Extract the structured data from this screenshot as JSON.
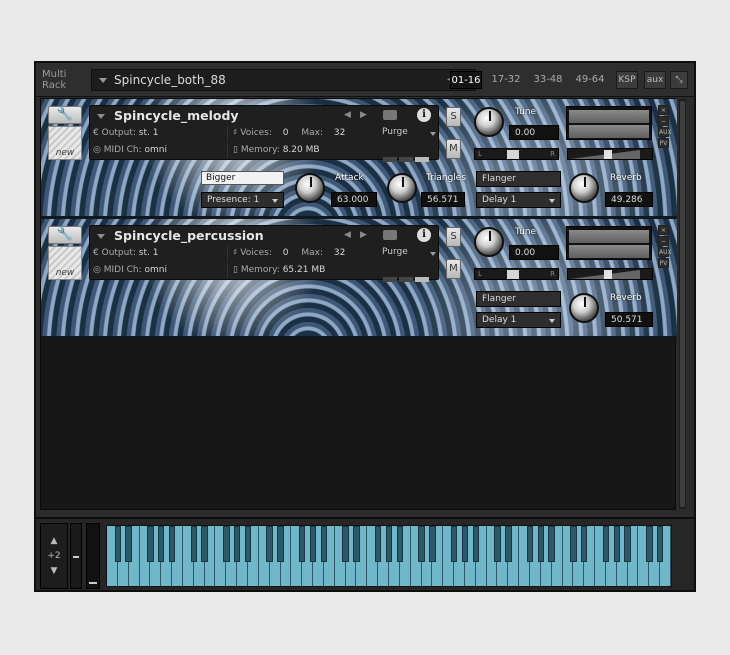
{
  "topbar": {
    "multi_rack_label": "Multi\nRack",
    "rack_name": "Spincycle_both_88",
    "pages": [
      "01-16",
      "17-32",
      "33-48",
      "49-64"
    ],
    "active_page": "01-16",
    "ksp_label": "KSP",
    "aux_label": "aux",
    "collapse_icon": "collapse-arrows-icon"
  },
  "instruments": [
    {
      "name": "Spincycle_melody",
      "output_label": "Output:",
      "output_value": "st. 1",
      "voices_label": "Voices:",
      "voices_value": "0",
      "max_label": "Max:",
      "max_value": "32",
      "midi_label": "MIDI Ch:",
      "midi_value": "omni",
      "memory_label": "Memory:",
      "memory_value": "8.20 MB",
      "purge_label": "Purge",
      "s_label": "S",
      "m_label": "M",
      "tune_label": "Tune",
      "tune_value": "0.00",
      "new_label": "new",
      "reverb_label": "Reverb",
      "reverb_value": "49.286",
      "fx1": "Flanger",
      "fx2": "Delay 1",
      "bigger_label": "Bigger",
      "presence_value": "Presence: 1",
      "attack_label": "Attack",
      "attack_value": "63.000",
      "triangles_label": "Triangles",
      "triangles_value": "56.571"
    },
    {
      "name": "Spincycle_percussion",
      "output_label": "Output:",
      "output_value": "st. 1",
      "voices_label": "Voices:",
      "voices_value": "0",
      "max_label": "Max:",
      "max_value": "32",
      "midi_label": "MIDI Ch:",
      "midi_value": "omni",
      "memory_label": "Memory:",
      "memory_value": "65.21 MB",
      "purge_label": "Purge",
      "s_label": "S",
      "m_label": "M",
      "tune_label": "Tune",
      "tune_value": "0.00",
      "new_label": "new",
      "reverb_label": "Reverb",
      "reverb_value": "50.571",
      "fx1": "Flanger",
      "fx2": "Delay 1"
    }
  ],
  "side": {
    "close": "×",
    "minus": "−",
    "aux": "AUX",
    "pv": "PV"
  },
  "pan": {
    "left": "L",
    "right": "R"
  },
  "vol": {
    "minus": "−",
    "plus": "+"
  },
  "keyboard": {
    "octave_value": "+2",
    "white_keys": 52,
    "black_pattern": [
      1,
      1,
      0,
      1,
      1,
      1,
      0
    ]
  },
  "colors": {
    "keys": "#6fb7c9",
    "black_keys": "#2d5868"
  }
}
